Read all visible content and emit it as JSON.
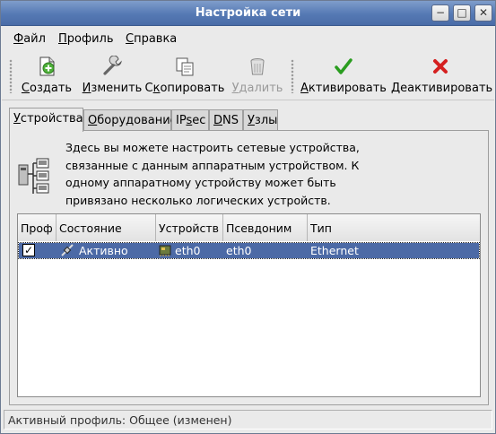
{
  "window": {
    "title": "Настройка сети"
  },
  "titlebar_buttons": {
    "minimize": "−",
    "maximize": "□",
    "close": "✕"
  },
  "menu": [
    {
      "accel": "Ф",
      "rest": "айл"
    },
    {
      "accel": "П",
      "rest": "рофиль"
    },
    {
      "accel": "С",
      "rest": "правка"
    }
  ],
  "toolbar": {
    "create": {
      "pre": "",
      "accel": "С",
      "post": "оздать",
      "icon": "new-document-icon"
    },
    "edit": {
      "pre": "",
      "accel": "И",
      "post": "зменить",
      "icon": "wrench-icon"
    },
    "copy": {
      "pre": "С",
      "accel": "к",
      "post": "опировать",
      "icon": "copy-icon"
    },
    "delete": {
      "pre": "",
      "accel": "У",
      "post": "далить",
      "icon": "trash-icon"
    },
    "activate": {
      "pre": "",
      "accel": "А",
      "post": "ктивировать",
      "icon": "checkmark-icon",
      "color": "#2a9d1f"
    },
    "deactivate": {
      "pre": "",
      "accel": "Д",
      "post": "еактивировать",
      "icon": "cross-icon",
      "color": "#d52020"
    }
  },
  "tabs": [
    {
      "pre": "",
      "accel": "У",
      "post": "стройства"
    },
    {
      "pre": "",
      "accel": "О",
      "post": "борудование"
    },
    {
      "pre": "IP",
      "accel": "s",
      "post": "ec"
    },
    {
      "pre": "",
      "accel": "D",
      "post": "NS"
    },
    {
      "pre": "",
      "accel": "У",
      "post": "злы"
    }
  ],
  "panel": {
    "description_lines": [
      "Здесь вы можете настроить сетевые устройства,",
      "связанные с данным аппаратным устройством. К",
      "одному аппаратному устройству может быть",
      "привязано несколько логических устройств."
    ],
    "icon": "network-devices-icon"
  },
  "table": {
    "columns": [
      "Проф",
      "Состояние",
      "Устройств",
      "Псевдоним",
      "Тип"
    ],
    "rows": [
      {
        "profile_checked": true,
        "status": "Активно",
        "device": "eth0",
        "alias": "eth0",
        "type": "Ethernet"
      }
    ]
  },
  "colors": {
    "selection": "#4c6aa6",
    "titlebar": "#5579b4"
  },
  "statusbar": {
    "text": "Активный профиль: Общее (изменен)"
  }
}
